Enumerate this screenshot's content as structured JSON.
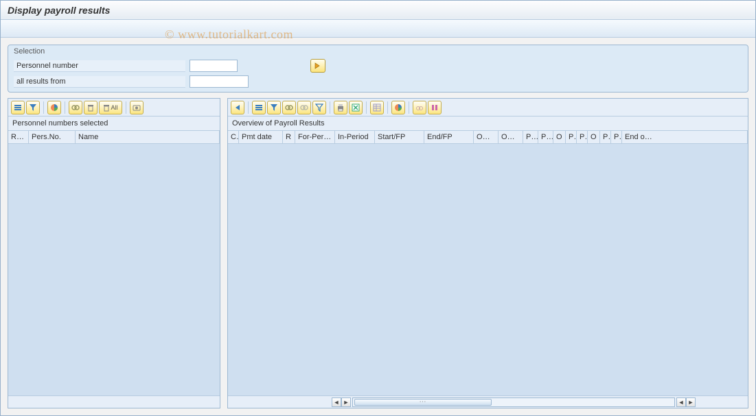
{
  "title": "Display payroll results",
  "watermark": "© www.tutorialkart.com",
  "selection": {
    "group_label": "Selection",
    "personnel_number_label": "Personnel number",
    "personnel_number_value": "",
    "all_results_label": "all results from",
    "all_results_value": ""
  },
  "left_panel": {
    "title": "Personnel numbers selected",
    "columns": [
      "R…",
      "Pers.No.",
      "Name"
    ]
  },
  "right_panel": {
    "title": "Overview of Payroll Results",
    "columns": [
      "C",
      "Pmt date",
      "R",
      "For-Peri…",
      "In-Period",
      "Start/FP",
      "End/FP",
      "OC …",
      "OC …",
      "P…",
      "P…",
      "O",
      "P",
      "P",
      "O",
      "P",
      "P",
      "End o…"
    ]
  },
  "toolbar_all_label": "All"
}
